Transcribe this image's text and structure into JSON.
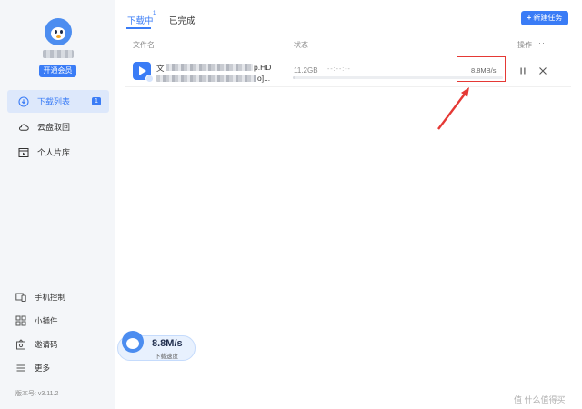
{
  "sidebar": {
    "vip_label": "开通会员",
    "nav": [
      {
        "label": "下载列表",
        "icon": "download-icon",
        "badge": "1",
        "active": true
      },
      {
        "label": "云盘取回",
        "icon": "cloud-icon"
      },
      {
        "label": "个人片库",
        "icon": "film-icon"
      }
    ],
    "tools": [
      {
        "label": "手机控制",
        "icon": "phone-icon"
      },
      {
        "label": "小插件",
        "icon": "grid-icon"
      },
      {
        "label": "邀请码",
        "icon": "gift-icon"
      },
      {
        "label": "更多",
        "icon": "menu-icon"
      }
    ],
    "version": "版本号: v3.11.2"
  },
  "speed_widget": {
    "speed": "8.8M/s",
    "label": "下载速度"
  },
  "header": {
    "tabs": [
      {
        "label": "下载中",
        "count": "1",
        "active": true
      },
      {
        "label": "已完成"
      }
    ],
    "new_task_label": "新建任务"
  },
  "table": {
    "columns": [
      "文件名",
      "状态",
      "操作"
    ],
    "more": "···"
  },
  "download": {
    "name_line1_prefix": "文",
    "name_line1_suffix": "p.HD",
    "name_line2_suffix": "o]...",
    "size": "11.2GB",
    "eta": "--:--:--",
    "rate": "8.8MB/s",
    "progress": 0.01
  },
  "colors": {
    "accent": "#3a7cf6",
    "highlight": "#e53935"
  },
  "watermark": "值 什么值得买"
}
